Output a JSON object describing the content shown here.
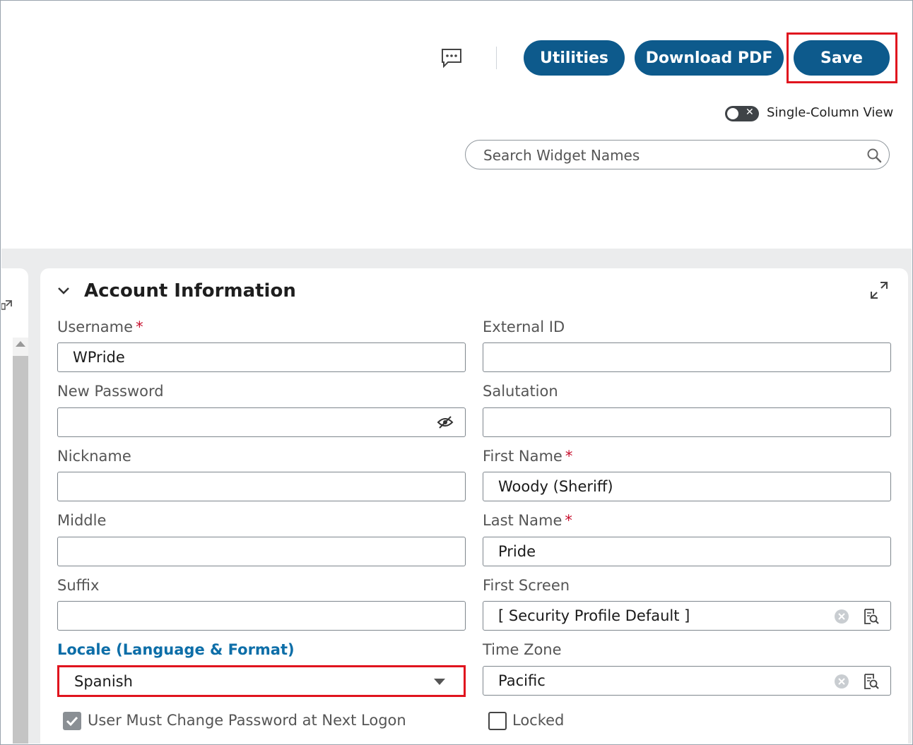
{
  "toolbar": {
    "utilities_label": "Utilities",
    "download_pdf_label": "Download PDF",
    "save_label": "Save",
    "single_column_label": "Single-Column View",
    "single_column_enabled": false,
    "search_placeholder": "Search Widget Names"
  },
  "section": {
    "title": "Account Information"
  },
  "fields": {
    "username": {
      "label": "Username",
      "required": "*",
      "value": "WPride"
    },
    "external_id": {
      "label": "External ID",
      "value": ""
    },
    "new_password": {
      "label": "New Password",
      "value": ""
    },
    "salutation": {
      "label": "Salutation",
      "value": ""
    },
    "nickname": {
      "label": "Nickname",
      "value": ""
    },
    "first_name": {
      "label": "First Name",
      "required": "*",
      "value": "Woody (Sheriff)"
    },
    "middle": {
      "label": "Middle",
      "value": ""
    },
    "last_name": {
      "label": "Last Name",
      "required": "*",
      "value": "Pride"
    },
    "suffix": {
      "label": "Suffix",
      "value": ""
    },
    "first_screen": {
      "label": "First Screen",
      "value": "[ Security Profile Default ]"
    },
    "locale": {
      "label": "Locale (Language & Format)",
      "value": "Spanish"
    },
    "time_zone": {
      "label": "Time Zone",
      "value": "Pacific"
    }
  },
  "checkboxes": {
    "must_change_password": {
      "label": "User Must Change Password at Next Logon",
      "checked": true
    },
    "locked": {
      "label": "Locked",
      "checked": false
    }
  },
  "colors": {
    "primary_button": "#0d5a8c",
    "highlight": "#e0141e",
    "required": "#c8102e",
    "locale_label": "#0d6ea8"
  }
}
